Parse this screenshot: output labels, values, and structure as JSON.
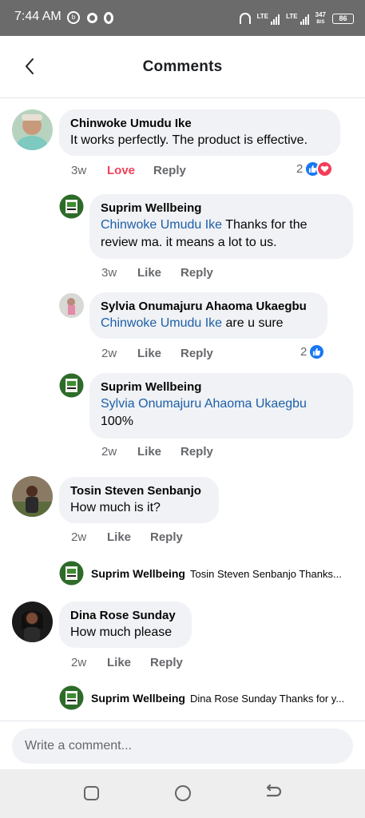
{
  "status_bar": {
    "time": "7:44 AM",
    "icons": [
      "b-icon",
      "circle-icon",
      "o-icon",
      "headphones-icon",
      "lte-signal-icon",
      "lte-signal-icon",
      "network-speed-icon",
      "battery-icon"
    ],
    "lte1": "LTE",
    "lte2": "LTE",
    "net_speed_value": "347",
    "net_speed_unit": "B/S",
    "battery": "86"
  },
  "header": {
    "title": "Comments",
    "back_icon": "chevron-left-icon"
  },
  "comments": [
    {
      "author": "Chinwoke Umudu Ike",
      "text": "It works perfectly. The product is effective.",
      "time": "3w",
      "action_react": "Love",
      "action_reply": "Reply",
      "reaction_count": "2",
      "reactions": [
        "like-icon",
        "love-icon"
      ],
      "replies": [
        {
          "author": "Suprim Wellbeing",
          "mention": "Chinwoke Umudu Ike",
          "text": " Thanks for the review ma. it means a lot to us.",
          "time": "3w",
          "action_react": "Like",
          "action_reply": "Reply"
        },
        {
          "author": "Sylvia Onumajuru Ahaoma Ukaegbu",
          "mention": "Chinwoke Umudu Ike",
          "text": " are u sure",
          "time": "2w",
          "action_react": "Like",
          "action_reply": "Reply",
          "reaction_count": "2",
          "reactions": [
            "like-icon"
          ]
        },
        {
          "author": "Suprim Wellbeing",
          "mention": "Sylvia Onumajuru Ahaoma Ukaegbu",
          "text": "100%",
          "time": "2w",
          "action_react": "Like",
          "action_reply": "Reply"
        }
      ]
    },
    {
      "author": "Tosin Steven Senbanjo",
      "text": "How much is it?",
      "time": "2w",
      "action_react": "Like",
      "action_reply": "Reply",
      "collapsed_reply": {
        "author": "Suprim Wellbeing",
        "text": "Tosin Steven Senbanjo Thanks..."
      }
    },
    {
      "author": "Dina Rose Sunday",
      "text": "How much please",
      "time": "2w",
      "action_react": "Like",
      "action_reply": "Reply",
      "collapsed_reply": {
        "author": "Suprim Wellbeing",
        "text": "Dina Rose Sunday Thanks for y..."
      }
    }
  ],
  "composer": {
    "placeholder": "Write a comment..."
  },
  "nav_bar": {
    "icons": [
      "recent-apps-icon",
      "home-icon",
      "back-icon"
    ]
  },
  "colors": {
    "status_bar": "#6b6b6b",
    "bubble": "#f0f2f5",
    "mention": "#1d5fa8",
    "love": "#f33e58",
    "like": "#1877f2",
    "meta": "#65676b"
  }
}
